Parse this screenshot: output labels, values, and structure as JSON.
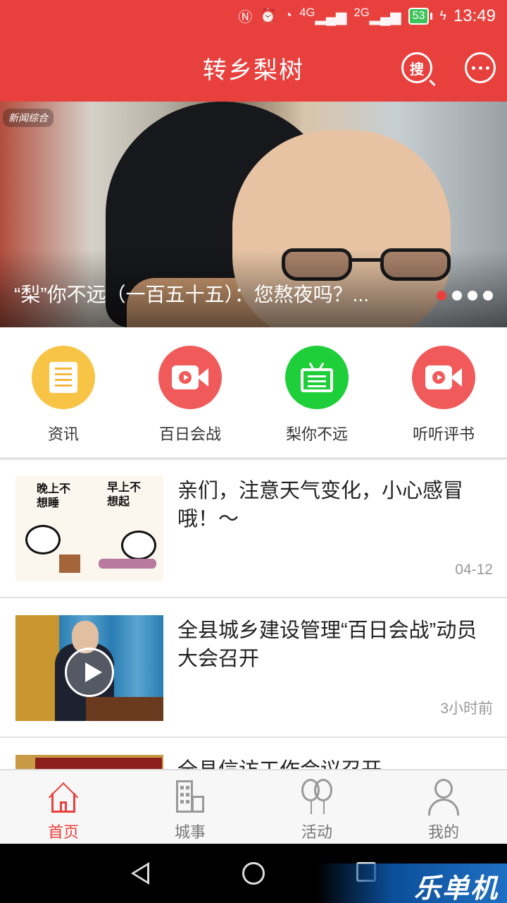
{
  "status": {
    "time": "13:49",
    "battery": "53",
    "net1": "4G",
    "net2": "2G"
  },
  "header": {
    "title": "转乡梨树",
    "search_glyph": "搜"
  },
  "banner": {
    "caption": "“梨”你不远（一百五十五）：您熬夜吗？...",
    "logo_text": "新闻综合",
    "slide_count": 4,
    "active_slide": 1
  },
  "categories": [
    {
      "label": "资讯",
      "color": "#f7c446",
      "icon": "document-icon"
    },
    {
      "label": "百日会战",
      "color": "#f15a5a",
      "icon": "video-camera-icon"
    },
    {
      "label": "梨你不远",
      "color": "#1fcf3a",
      "icon": "tv-icon"
    },
    {
      "label": "听听评书",
      "color": "#f15a5a",
      "icon": "video-camera-icon"
    }
  ],
  "news": [
    {
      "title": "亲们，注意天气变化，小心感冒哦！～",
      "time": "04-12",
      "thumb_text_1": "晚上不想睡",
      "thumb_text_2": "早上不想起"
    },
    {
      "title": "全县城乡建设管理“百日会战”动员大会召开",
      "time": "3小时前"
    },
    {
      "title": "全县信访工作会议召开",
      "time": ""
    }
  ],
  "bottom_nav": [
    {
      "label": "首页",
      "icon": "home-icon",
      "active": true
    },
    {
      "label": "城事",
      "icon": "building-icon",
      "active": false
    },
    {
      "label": "活动",
      "icon": "balloon-icon",
      "active": false
    },
    {
      "label": "我的",
      "icon": "user-icon",
      "active": false
    }
  ],
  "watermark": "乐单机",
  "colors": {
    "brand_red": "#e8403d",
    "text_dark": "#222222",
    "text_gray": "#999999"
  }
}
